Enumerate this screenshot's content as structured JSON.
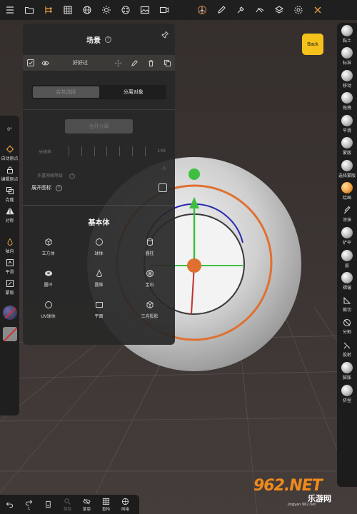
{
  "top_toolbar": {
    "icons": [
      "menu-icon",
      "folder-icon",
      "scene-tree-icon",
      "grid-icon",
      "globe-icon",
      "sun-icon",
      "material-icon",
      "image-icon",
      "video-icon",
      "gizmo-icon",
      "pen-icon",
      "dropper-icon",
      "curve-icon",
      "layers-icon",
      "settings-icon",
      "tools-icon"
    ]
  },
  "left_tools": {
    "angle": "0°",
    "items": [
      {
        "label": "自动原点",
        "icon": "crosshair-icon"
      },
      {
        "label": "编辑原点",
        "icon": "lock-icon"
      },
      {
        "label": "克隆",
        "icon": "clone-icon"
      },
      {
        "label": "对称",
        "icon": "symmetry-icon"
      },
      {
        "label": "轴向",
        "icon": "drop-icon"
      },
      {
        "label": "平滑",
        "icon": "smooth-icon"
      },
      {
        "label": "蒙版",
        "icon": "mask-icon"
      }
    ]
  },
  "back_button": "Back",
  "panel": {
    "title": "场景",
    "object_name": "好好过",
    "seg_left": "合并选择",
    "seg_right": "分离对象",
    "disabled_button": "合并分离",
    "slider_label": "分辨率",
    "slider_value": "149",
    "sub_label": "多重网格等级",
    "sub_value": "0",
    "expand_label": "展开图标",
    "primitives_title": "基本体",
    "primitives": [
      {
        "label": "立方体",
        "icon": "cube-icon"
      },
      {
        "label": "球体",
        "icon": "sphere-icon"
      },
      {
        "label": "圆柱",
        "icon": "cylinder-icon"
      },
      {
        "label": "圆环",
        "icon": "torus-icon"
      },
      {
        "label": "圆锥",
        "icon": "cone-icon"
      },
      {
        "label": "宝石",
        "icon": "gem-icon"
      },
      {
        "label": "UV球体",
        "icon": "uv-sphere-icon"
      },
      {
        "label": "平面",
        "icon": "plane-icon"
      },
      {
        "label": "三向投影",
        "icon": "triplanar-icon"
      }
    ]
  },
  "right_tools": [
    {
      "label": "黏土",
      "icon": "clay-brush-icon"
    },
    {
      "label": "标准",
      "icon": "standard-brush-icon"
    },
    {
      "label": "移动",
      "icon": "move-brush-icon"
    },
    {
      "label": "拖拽",
      "icon": "drag-brush-icon"
    },
    {
      "label": "平滑",
      "icon": "smooth-brush-icon"
    },
    {
      "label": "蒙版",
      "icon": "mask-brush-icon"
    },
    {
      "label": "选择蒙版",
      "icon": "select-mask-icon"
    },
    {
      "label": "绘画",
      "icon": "paint-brush-icon"
    },
    {
      "label": "涂抹",
      "icon": "smudge-icon"
    },
    {
      "label": "铲平",
      "icon": "flatten-icon"
    },
    {
      "label": "层",
      "icon": "layer-brush-icon"
    },
    {
      "label": "褶皱",
      "icon": "crease-icon"
    },
    {
      "label": "裁切",
      "icon": "trim-icon"
    },
    {
      "label": "分割",
      "icon": "split-icon"
    },
    {
      "label": "投射",
      "icon": "project-icon"
    },
    {
      "label": "膨胀",
      "icon": "inflate-icon"
    },
    {
      "label": "挤捏",
      "icon": "pinch-icon"
    }
  ],
  "bottom_bar": [
    {
      "label": "",
      "icon": "undo-icon"
    },
    {
      "label": "1",
      "icon": "redo-icon"
    },
    {
      "label": "",
      "icon": "file-icon"
    },
    {
      "label": "剪裁",
      "icon": "search-icon",
      "dim": true
    },
    {
      "label": "蒙版",
      "icon": "eye-off-icon"
    },
    {
      "label": "重构",
      "icon": "remesh-icon"
    },
    {
      "label": "网格",
      "icon": "mesh-icon"
    }
  ],
  "watermark": {
    "brand": "962.NET",
    "cn": "乐游网",
    "url": "jingyan.962.net"
  },
  "colors": {
    "accent": "#f5c21b",
    "gizmo_orange": "#e07030",
    "gizmo_green": "#3fbf3f",
    "gizmo_blue": "#3030c0",
    "gizmo_red": "#c03030"
  }
}
